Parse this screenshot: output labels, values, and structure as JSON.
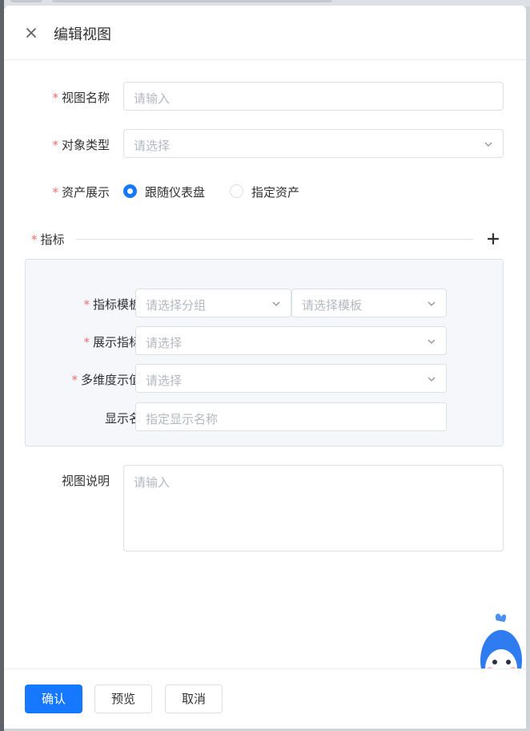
{
  "header": {
    "title": "编辑视图"
  },
  "form": {
    "view_name": {
      "label": "视图名称",
      "placeholder": "请输入"
    },
    "object_type": {
      "label": "对象类型",
      "placeholder": "请选择"
    },
    "asset_display": {
      "label": "资产展示",
      "options": [
        {
          "label": "跟随仪表盘",
          "checked": true
        },
        {
          "label": "指定资产",
          "checked": false
        }
      ]
    },
    "metrics": {
      "section_label": "指标",
      "template": {
        "label": "指标模板",
        "group_placeholder": "请选择分组",
        "template_placeholder": "请选择模板"
      },
      "display_metric": {
        "label": "展示指标",
        "placeholder": "请选择"
      },
      "dimension_value": {
        "label": "多维度示值",
        "placeholder": "请选择"
      },
      "display_name": {
        "label": "显示名",
        "placeholder": "指定显示名称"
      }
    },
    "description": {
      "label": "视图说明",
      "placeholder": "请输入"
    }
  },
  "footer": {
    "confirm": "确认",
    "preview": "预览",
    "cancel": "取消"
  },
  "colors": {
    "primary": "#1677ff",
    "required": "#f56c6c",
    "placeholder": "#b4b8bf"
  }
}
